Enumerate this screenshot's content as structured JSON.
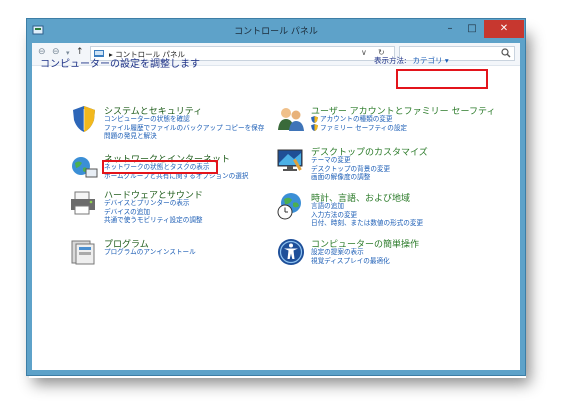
{
  "window": {
    "title": "コントロール パネル",
    "min_glyph": "–",
    "max_glyph": "□",
    "close_glyph": "✕"
  },
  "address": {
    "back": "⊖",
    "forward": "⊖",
    "up": "↑",
    "path": "▸ コントロール パネル",
    "dropdown": "∨",
    "refresh": "↻",
    "search_placeholder": ""
  },
  "main": {
    "title": "コンピューターの設定を調整します",
    "viewby_label": "表示方法:",
    "viewby_value": "カテゴリ ▾"
  },
  "categories": [
    {
      "title": "システムとセキュリティ",
      "links": [
        "コンピューターの状態を確認",
        "ファイル履歴でファイルのバックアップ コピーを保存",
        "問題の発見と解決"
      ]
    },
    {
      "title": "ネットワークとインターネット",
      "links": [
        "ネットワークの状態とタスクの表示",
        "ホームグループと共有に関するオプションの選択"
      ]
    },
    {
      "title": "ハードウェアとサウンド",
      "links": [
        "デバイスとプリンターの表示",
        "デバイスの追加",
        "共通で使うモビリティ設定の調整"
      ]
    },
    {
      "title": "プログラム",
      "links": [
        "プログラムのアンインストール"
      ]
    },
    {
      "title": "ユーザー アカウントとファミリー セーフティ",
      "links": [
        "アカウントの種類の変更",
        "ファミリー セーフティの設定"
      ]
    },
    {
      "title": "デスクトップのカスタマイズ",
      "links": [
        "テーマの変更",
        "デスクトップの背景の変更",
        "画面の解像度の調整"
      ]
    },
    {
      "title": "時計、言語、および地域",
      "links": [
        "言語の追加",
        "入力方法の変更",
        "日付、時刻、または数値の形式の変更"
      ]
    },
    {
      "title": "コンピューターの簡単操作",
      "links": [
        "設定の提案の表示",
        "視覚ディスプレイの最適化"
      ]
    }
  ],
  "colors": {
    "frame": "#5ea2c9",
    "link": "#1a5cb5",
    "category_title": "#1e5c1a",
    "highlight": "#e3141b"
  }
}
